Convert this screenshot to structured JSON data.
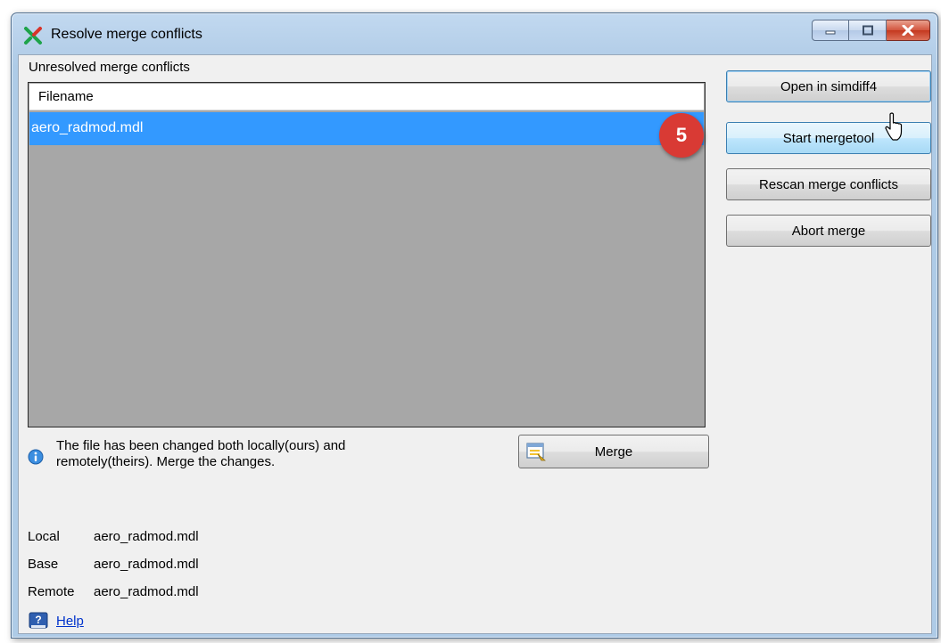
{
  "window": {
    "title": "Resolve merge conflicts",
    "caption_buttons": [
      "minimize",
      "maximize",
      "close"
    ]
  },
  "conflicts": {
    "section_label": "Unresolved merge conflicts",
    "column_header": "Filename",
    "rows": [
      {
        "filename": "aero_radmod.mdl",
        "selected": true
      }
    ]
  },
  "callout_badge": "5",
  "actions": {
    "open_label": "Open in simdiff4",
    "start_label": "Start mergetool",
    "rescan_label": "Rescan merge conflicts",
    "abort_label": "Abort merge"
  },
  "info": {
    "message_line1": "The file has been changed both locally(ours) and",
    "message_line2": "remotely(theirs). Merge the changes.",
    "merge_label": "Merge"
  },
  "details": {
    "local_label": "Local",
    "local_value": "aero_radmod.mdl",
    "base_label": "Base",
    "base_value": "aero_radmod.mdl",
    "remote_label": "Remote",
    "remote_value": "aero_radmod.mdl"
  },
  "help": {
    "label": "Help"
  },
  "colors": {
    "selection": "#3399ff",
    "list_background": "#a7a7a7",
    "badge": "#d93a34",
    "link": "#0033cc"
  },
  "icons": {
    "app": "merge-x-icon",
    "info": "info-icon",
    "merge": "merge-document-icon",
    "help": "help-book-icon",
    "cursor": "mouse-pointer-icon"
  }
}
